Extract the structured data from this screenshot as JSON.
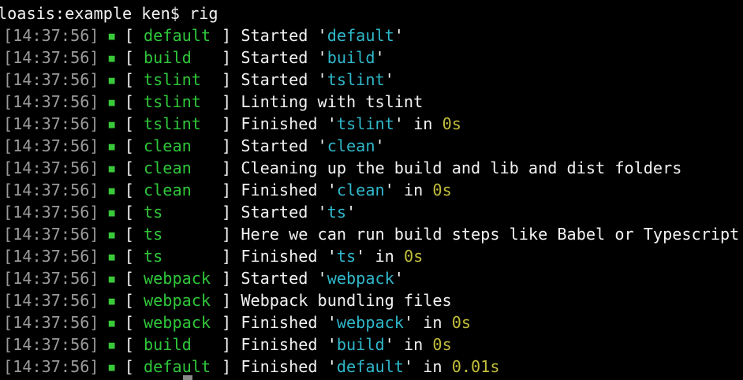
{
  "terminal": {
    "prompt": "loasis:example ken$",
    "command": "rig",
    "bullet_glyph": "■",
    "bracket_open": "[",
    "bracket_close": "]",
    "lines": [
      {
        "time": "[14:37:56]",
        "task": "default",
        "pre": "Started '",
        "quoted": "default",
        "post": "'",
        "dur_pre": "",
        "duration": ""
      },
      {
        "time": "[14:37:56]",
        "task": "build",
        "pre": "Started '",
        "quoted": "build",
        "post": "'",
        "dur_pre": "",
        "duration": ""
      },
      {
        "time": "[14:37:56]",
        "task": "tslint",
        "pre": "Started '",
        "quoted": "tslint",
        "post": "'",
        "dur_pre": "",
        "duration": ""
      },
      {
        "time": "[14:37:56]",
        "task": "tslint",
        "pre": "Linting with tslint",
        "quoted": "",
        "post": "",
        "dur_pre": "",
        "duration": ""
      },
      {
        "time": "[14:37:56]",
        "task": "tslint",
        "pre": "Finished '",
        "quoted": "tslint",
        "post": "'",
        "dur_pre": " in ",
        "duration": "0s"
      },
      {
        "time": "[14:37:56]",
        "task": "clean",
        "pre": "Started '",
        "quoted": "clean",
        "post": "'",
        "dur_pre": "",
        "duration": ""
      },
      {
        "time": "[14:37:56]",
        "task": "clean",
        "pre": "Cleaning up the build and lib and dist folders",
        "quoted": "",
        "post": "",
        "dur_pre": "",
        "duration": ""
      },
      {
        "time": "[14:37:56]",
        "task": "clean",
        "pre": "Finished '",
        "quoted": "clean",
        "post": "'",
        "dur_pre": " in ",
        "duration": "0s"
      },
      {
        "time": "[14:37:56]",
        "task": "ts",
        "pre": "Started '",
        "quoted": "ts",
        "post": "'",
        "dur_pre": "",
        "duration": ""
      },
      {
        "time": "[14:37:56]",
        "task": "ts",
        "pre": "Here we can run build steps like Babel or Typescript",
        "quoted": "",
        "post": "",
        "dur_pre": "",
        "duration": ""
      },
      {
        "time": "[14:37:56]",
        "task": "ts",
        "pre": "Finished '",
        "quoted": "ts",
        "post": "'",
        "dur_pre": " in ",
        "duration": "0s"
      },
      {
        "time": "[14:37:56]",
        "task": "webpack",
        "pre": "Started '",
        "quoted": "webpack",
        "post": "'",
        "dur_pre": "",
        "duration": ""
      },
      {
        "time": "[14:37:56]",
        "task": "webpack",
        "pre": "Webpack bundling files",
        "quoted": "",
        "post": "",
        "dur_pre": "",
        "duration": ""
      },
      {
        "time": "[14:37:56]",
        "task": "webpack",
        "pre": "Finished '",
        "quoted": "webpack",
        "post": "'",
        "dur_pre": " in ",
        "duration": "0s"
      },
      {
        "time": "[14:37:56]",
        "task": "build",
        "pre": "Finished '",
        "quoted": "build",
        "post": "'",
        "dur_pre": " in ",
        "duration": "0s"
      },
      {
        "time": "[14:37:56]",
        "task": "default",
        "pre": "Finished '",
        "quoted": "default",
        "post": "'",
        "dur_pre": " in ",
        "duration": "0.01s"
      }
    ]
  },
  "colors": {
    "background": "#000000",
    "timestamp": "#9a9a9a",
    "task": "#2fc63a",
    "bullet": "#39c93a",
    "quoted": "#2fb7c9",
    "duration": "#c2bd3b",
    "text": "#f2f2f2"
  }
}
